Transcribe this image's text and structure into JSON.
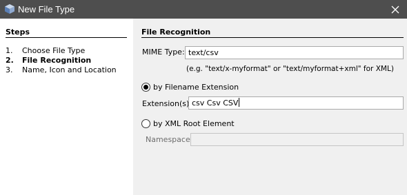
{
  "window": {
    "title": "New File Type",
    "icon": "cube-icon",
    "close_icon": "close-icon"
  },
  "steps": {
    "heading": "Steps",
    "items": [
      {
        "number": "1.",
        "label": "Choose File Type",
        "active": false
      },
      {
        "number": "2.",
        "label": "File Recognition",
        "active": true
      },
      {
        "number": "3.",
        "label": "Name, Icon and Location",
        "active": false
      }
    ]
  },
  "panel": {
    "heading": "File Recognition",
    "mime_label": "MIME Type:",
    "mime_value": "text/csv",
    "mime_hint": "(e.g. \"text/x-myformat\" or \"text/myformat+xml\" for XML)",
    "radio_extension": {
      "label": "by Filename Extension",
      "selected": true
    },
    "extension_label": "Extension(s):",
    "extension_value": "csv Csv CSV",
    "radio_xml": {
      "label": "by XML Root Element",
      "selected": false
    },
    "namespace_label": "Namespace:",
    "namespace_value": ""
  }
}
